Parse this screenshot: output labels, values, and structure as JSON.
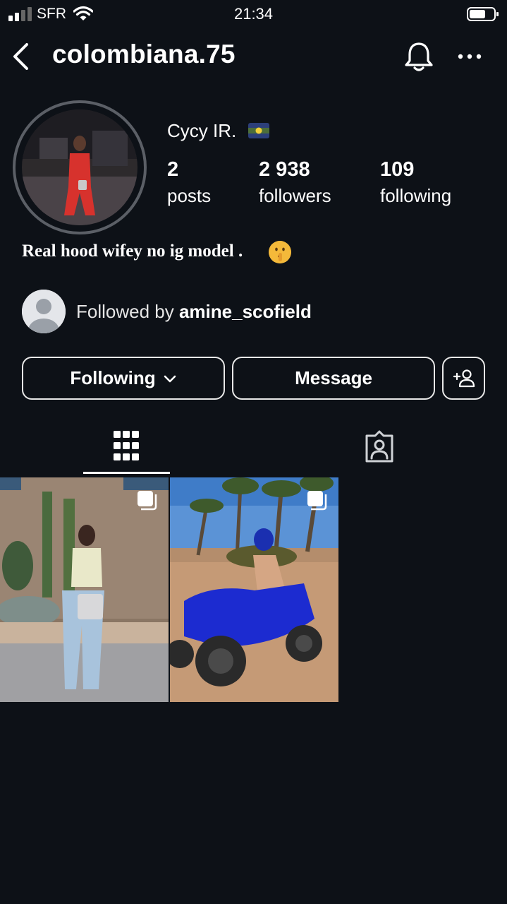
{
  "status_bar": {
    "carrier": "SFR",
    "time": "21:34"
  },
  "header": {
    "username": "colombiana.75"
  },
  "profile": {
    "display_name": "Cycy IR.",
    "stats": [
      {
        "value": "2",
        "label": "posts"
      },
      {
        "value": "2 938",
        "label": "followers"
      },
      {
        "value": "109",
        "label": "following"
      }
    ],
    "bio": "Real hood wifey no ig model ."
  },
  "followed_by": {
    "prefix": "Followed by ",
    "username": "amine_scofield"
  },
  "actions": {
    "following_label": "Following",
    "message_label": "Message"
  },
  "tabs": [
    {
      "icon": "grid-icon",
      "active": true
    },
    {
      "icon": "tagged-icon",
      "active": false
    }
  ],
  "posts": [
    {
      "icon": "multiple-photos-icon"
    },
    {
      "icon": "multiple-photos-icon"
    }
  ],
  "colors": {
    "background": "#0d1117",
    "text": "#ffffff",
    "border": "#e8e8e8",
    "ring": "#5b5f66"
  }
}
